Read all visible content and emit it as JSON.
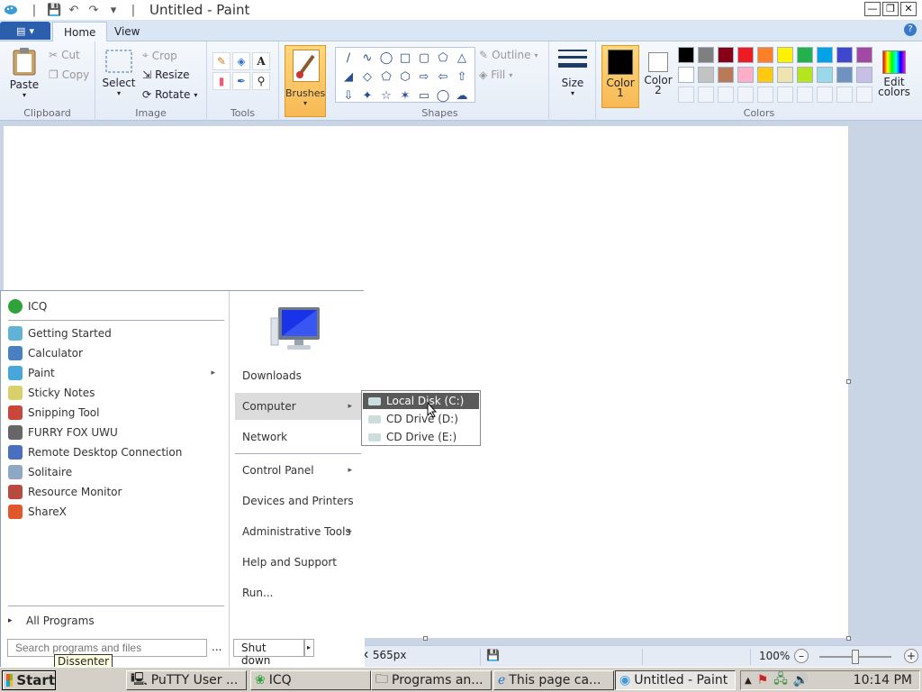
{
  "window": {
    "title": "Untitled - Paint"
  },
  "ribbon": {
    "tabs": [
      {
        "label": "Home"
      },
      {
        "label": "View"
      }
    ],
    "clipboard": {
      "paste": "Paste",
      "cut": "Cut",
      "copy": "Copy",
      "label": "Clipboard"
    },
    "image": {
      "select": "Select",
      "crop": "Crop",
      "resize": "Resize",
      "rotate": "Rotate",
      "label": "Image"
    },
    "tools": {
      "label": "Tools"
    },
    "brushes": {
      "label": "Brushes"
    },
    "shapes": {
      "outline": "Outline",
      "fill": "Fill",
      "label": "Shapes"
    },
    "size": {
      "label": "Size"
    },
    "colors": {
      "color1": "Color\n1",
      "color1_a": "Color",
      "color1_b": "1",
      "color2_a": "Color",
      "color2_b": "2",
      "edit_a": "Edit",
      "edit_b": "colors",
      "label": "Colors",
      "palette_row1": [
        "#000000",
        "#7f7f7f",
        "#880015",
        "#ed1c24",
        "#ff7f27",
        "#fff200",
        "#22b14c",
        "#00a2e8",
        "#3f48cc",
        "#a349a4"
      ],
      "palette_row2": [
        "#ffffff",
        "#c3c3c3",
        "#b97a57",
        "#ffaec9",
        "#ffc90e",
        "#efe4b0",
        "#b5e61d",
        "#99d9ea",
        "#7092be",
        "#c8bfe7"
      ]
    }
  },
  "statusbar": {
    "size": "565px",
    "zoom": "100%"
  },
  "startmenu": {
    "pinned": [
      {
        "label": "ICQ",
        "icon": "icq-icon",
        "color": "#2fa33a"
      }
    ],
    "recent": [
      {
        "label": "Getting Started",
        "icon": "getting-started-icon",
        "color": "#62b2d6"
      },
      {
        "label": "Calculator",
        "icon": "calculator-icon",
        "color": "#4a7fc2"
      },
      {
        "label": "Paint",
        "icon": "paint-icon",
        "color": "#49a6d8"
      },
      {
        "label": "Sticky Notes",
        "icon": "sticky-notes-icon",
        "color": "#d8d06a"
      },
      {
        "label": "Snipping Tool",
        "icon": "snipping-tool-icon",
        "color": "#c9463b"
      },
      {
        "label": "FURRY FOX UWU",
        "icon": "app-window-icon",
        "color": "#666666"
      },
      {
        "label": "Remote Desktop Connection",
        "icon": "remote-desktop-icon",
        "color": "#4a6fbe"
      },
      {
        "label": "Solitaire",
        "icon": "solitaire-icon",
        "color": "#8fa6c4"
      },
      {
        "label": "Resource Monitor",
        "icon": "resource-monitor-icon",
        "color": "#b94a3f"
      },
      {
        "label": "ShareX",
        "icon": "sharex-icon",
        "color": "#e2562c"
      }
    ],
    "all_programs": "All Programs",
    "search_placeholder": "Search programs and files",
    "search_more": "...",
    "shutdown": "Shut down",
    "right": [
      {
        "label": "Downloads"
      },
      {
        "label": "Computer"
      },
      {
        "label": "Network"
      },
      {
        "label": "Control Panel"
      },
      {
        "label": "Devices and Printers"
      },
      {
        "label": "Administrative Tools"
      },
      {
        "label": "Help and Support"
      },
      {
        "label": "Run..."
      }
    ],
    "computer_submenu": [
      {
        "label": "Local Disk (C:)"
      },
      {
        "label": "CD Drive (D:)"
      },
      {
        "label": "CD Drive (E:)"
      }
    ]
  },
  "tooltip": "Dissenter",
  "taskbar": {
    "start": "Start",
    "tasks": [
      {
        "label": "PuTTY User ..."
      },
      {
        "label": "ICQ"
      },
      {
        "label": "Programs an..."
      },
      {
        "label": "This page ca..."
      },
      {
        "label": "Untitled - Paint"
      }
    ],
    "clock": "10:14 PM"
  }
}
